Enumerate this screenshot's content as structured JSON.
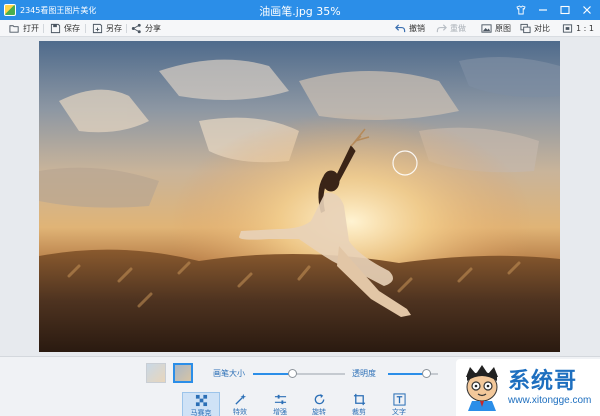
{
  "window": {
    "app_name": "2345看图王图片美化",
    "document_title": "油画笔.jpg  35%"
  },
  "toolbar": {
    "left": [
      {
        "label": "打开",
        "icon": "folder-open-icon"
      },
      {
        "label": "保存",
        "icon": "save-icon"
      },
      {
        "label": "另存",
        "icon": "save-as-icon"
      },
      {
        "label": "分享",
        "icon": "share-icon"
      }
    ],
    "right": [
      {
        "label": "撤销",
        "icon": "undo-icon",
        "enabled": true
      },
      {
        "label": "重做",
        "icon": "redo-icon",
        "enabled": false
      },
      {
        "label": "原图",
        "icon": "original-image-icon",
        "enabled": true
      },
      {
        "label": "对比",
        "icon": "compare-icon",
        "enabled": true
      }
    ],
    "zoom_label": "1 : 1"
  },
  "bottom": {
    "brush_size_label": "画笔大小",
    "brush_size_value": 0.42,
    "opacity_label": "透明度",
    "opacity_value": 0.76,
    "tools": [
      {
        "label": "马赛克",
        "icon": "mosaic-icon",
        "active": true
      },
      {
        "label": "特效",
        "icon": "effects-icon",
        "active": false
      },
      {
        "label": "增强",
        "icon": "adjust-sliders-icon",
        "active": false
      },
      {
        "label": "旋转",
        "icon": "rotate-icon",
        "active": false
      },
      {
        "label": "裁剪",
        "icon": "crop-icon",
        "active": false
      },
      {
        "label": "文字",
        "icon": "text-icon",
        "active": false
      }
    ]
  },
  "watermark": {
    "brand": "系统哥",
    "url": "www.xitongge.com"
  },
  "colors": {
    "accent": "#2b8ee8",
    "title_bar": "#2b8ee8",
    "watermark_blue": "#1e6fbf"
  }
}
